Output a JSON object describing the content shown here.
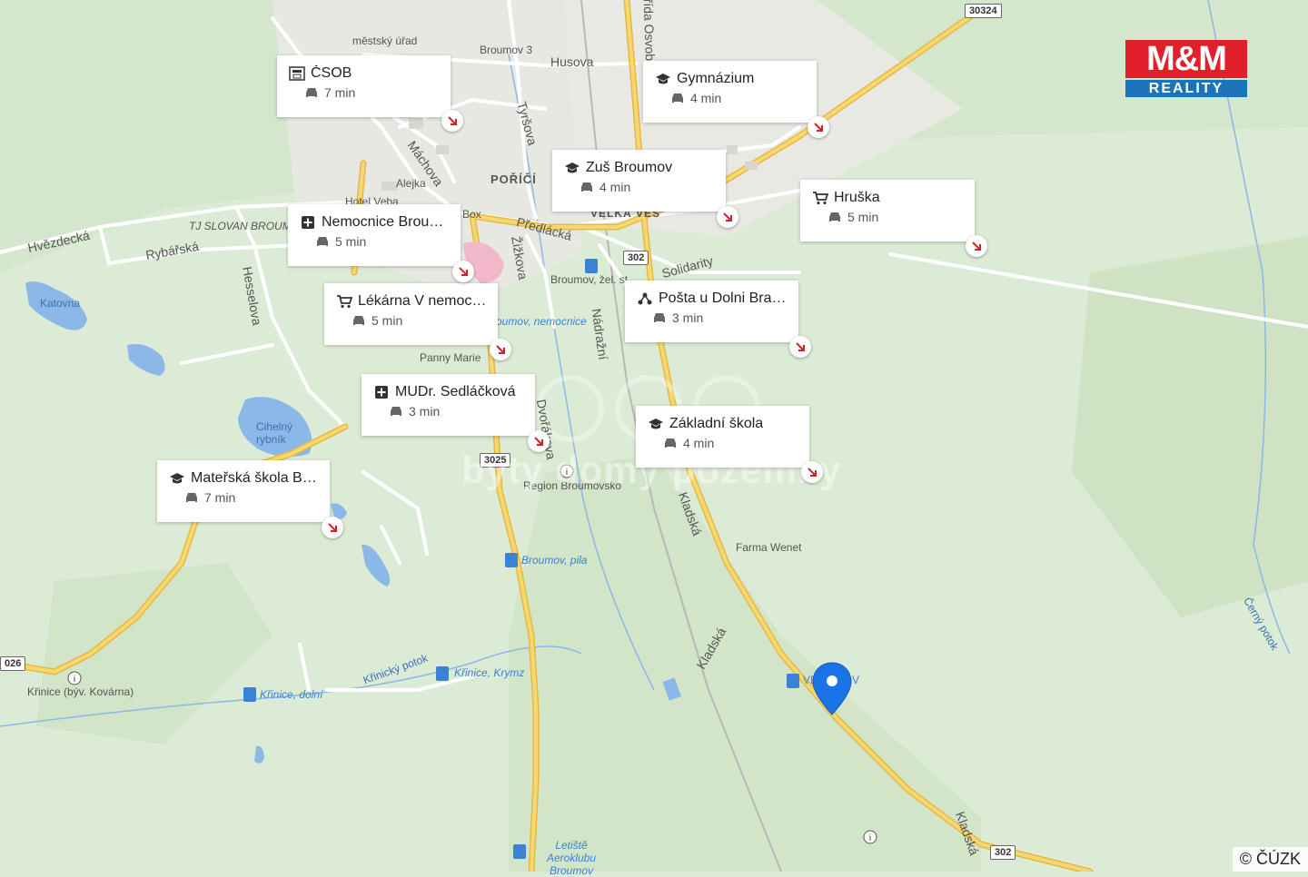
{
  "poi_cards": [
    {
      "name": "ČSOB",
      "time": "7 min",
      "icon": "bank-icon"
    },
    {
      "name": "Gymnázium",
      "time": "4 min",
      "icon": "school-icon"
    },
    {
      "name": "Zuš Broumov",
      "time": "4 min",
      "icon": "school-icon"
    },
    {
      "name": "Hruška",
      "time": "5 min",
      "icon": "shop-cart-icon"
    },
    {
      "name": "Nemocnice Broumov",
      "time": "5 min",
      "icon": "medical-cross-icon"
    },
    {
      "name": "Lékárna V nemocnici",
      "time": "5 min",
      "icon": "shop-cart-icon"
    },
    {
      "name": "Pošta u Dolni Branky",
      "time": "3 min",
      "icon": "post-office-icon"
    },
    {
      "name": "MUDr. Sedláčková",
      "time": "3 min",
      "icon": "medical-cross-icon"
    },
    {
      "name": "Základní škola",
      "time": "4 min",
      "icon": "school-icon"
    },
    {
      "name": "Mateřská škola Broumov",
      "time": "7 min",
      "icon": "school-icon"
    }
  ],
  "map_labels": {
    "street_hvezdecka": "Hvězdecká",
    "street_rybarska": "Rybářská",
    "street_hesselova": "Hesselova",
    "street_machova": "Máchova",
    "street_tyrsova": "Tyršova",
    "street_husova": "Husova",
    "street_predlacka": "Předlácká",
    "street_zizkova": "Žižkova",
    "street_nadrazni": "Nádražní",
    "street_solidarity": "Solidarity",
    "street_kladska": "Kladská",
    "street_kladska2": "Kladská",
    "street_kladska3": "Kladská",
    "street_trida": "třída Osvobození",
    "street_dvorakova": "Dvořákova",
    "district_porici": "POŘÍČÍ",
    "district_velkaves": "VELKÁ VES",
    "place_mestsky_urad": "městský úřad",
    "place_broumov3": "Broumov 3",
    "place_alejka": "Alejka",
    "place_hotel": "Hotel Veba",
    "place_tjslovan": "TJ SLOVAN BROUMOV",
    "place_katovna": "Katovna",
    "place_cihelny": "Cihelný rybník",
    "place_stop_nemocnice": "Broumov, nemocnice",
    "place_panny_marie": "Panny Marie",
    "place_zel_st": "Broumov, žel. st.",
    "place_region": "Region Broumovsko",
    "place_pila": "Broumov, pila",
    "place_farma": "Farma Wenet",
    "place_krinice_kovarna": "Křinice (býv. Kovárna)",
    "place_krinice_dolni": "Křinice, dolní",
    "place_krinice_krymz": "Křinice, Krymz",
    "place_krinicky_potok": "Křinický potok",
    "place_cerny_potok": "Černý potok",
    "place_letiste": "Letiště Aeroklubu Broumov",
    "place_box": "Box",
    "place_vel": "VEL... ČOV"
  },
  "road_numbers": {
    "r30324": "30324",
    "r302a": "302",
    "r302b": "302",
    "r3025": "3025",
    "r026": "026"
  },
  "watermark": "byty domy pozemky",
  "logo": {
    "line1": "M&M",
    "line2": "REALITY",
    "color_red": "#e2202c",
    "color_blue": "#1b74b8"
  },
  "copyright": "© ČÚZK",
  "colors": {
    "map_bg": "#dcebd5",
    "road_main": "#f2c94c",
    "road_minor": "#ffffff",
    "water": "#8cb8e8",
    "pin": "#1a73e8",
    "arrow_red": "#d0202c"
  }
}
